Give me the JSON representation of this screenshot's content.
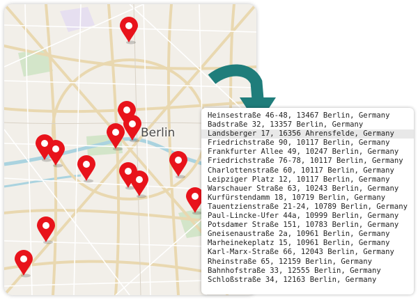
{
  "map": {
    "city_label": "Berlin",
    "pin_color": "#e8131b",
    "land_color": "#f2efe9",
    "road_color": "#e9d8b0",
    "water_color": "#aad3df",
    "park_color": "#d3e5c9",
    "pin_icon": "map-marker-icon"
  },
  "arrow": {
    "color": "#1f7d7b",
    "icon": "curved-arrow-down-icon"
  },
  "address_list": {
    "highlighted_index": 2,
    "items": [
      "Heinsestraße 46-48, 13467 Berlin, Germany",
      "Badstraße 32, 13357 Berlin, Germany",
      "Landsberger 17, 16356 Ahrensfelde, Germany",
      "Friedrichstraße 90, 10117 Berlin, Germany",
      "Frankfurter Allee 49, 10247 Berlin, Germany",
      "Friedrichstraße 76-78, 10117 Berlin, Germany",
      "Charlottenstraße 60, 10117 Berlin, Germany",
      "Leipziger Platz 12, 10117 Berlin, Germany",
      "Warschauer Straße 63, 10243 Berlin, Germany",
      "Kurfürstendamm 18, 10719 Berlin, Germany",
      "Tauentzienstraße 21-24, 10789 Berlin, Germany",
      "Paul-Lincke-Ufer 44a, 10999 Berlin, Germany",
      "Potsdamer Straße 151, 10783 Berlin, Germany",
      "Gneisenaustraße 2a, 10961 Berlin, Germany",
      "Marheinekeplatz 15, 10961 Berlin, Germany",
      "Karl-Marx-Straße 66, 12043 Berlin, Germany",
      "Rheinstraße 65, 12159 Berlin, Germany",
      "Bahnhofstraße 33, 12555 Berlin, Germany",
      "Schloßstraße 34, 12163 Berlin, Germany"
    ]
  }
}
